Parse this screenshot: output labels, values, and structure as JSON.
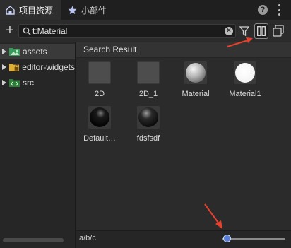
{
  "tabs": [
    {
      "label": "项目资源",
      "icon": "home-icon"
    },
    {
      "label": "小部件",
      "icon": "star-icon"
    }
  ],
  "header": {
    "help_label": "?"
  },
  "search": {
    "value": "t:Material",
    "clear_label": "×"
  },
  "toolbar": {
    "add_label": "+"
  },
  "tree": {
    "items": [
      {
        "label": "assets",
        "icon": "image-folder-icon",
        "expanded": false
      },
      {
        "label": "editor-widgets",
        "icon": "lock-folder-icon",
        "expanded": false
      },
      {
        "label": "src",
        "icon": "code-folder-icon",
        "expanded": false
      }
    ]
  },
  "results": {
    "title": "Search Result",
    "assets": [
      {
        "label": "2D",
        "kind": "sprite"
      },
      {
        "label": "2D_1",
        "kind": "sprite"
      },
      {
        "label": "Material",
        "kind": "material-gray"
      },
      {
        "label": "Material1",
        "kind": "material-white"
      },
      {
        "label": "Default…",
        "kind": "material-black"
      },
      {
        "label": "fdsfsdf",
        "kind": "material-dark"
      }
    ]
  },
  "footer": {
    "path": "a/b/c",
    "zoom_level": 0.0
  },
  "colors": {
    "accent": "#5a7fd6",
    "annotation": "#e8402b",
    "panel": "#2b2b2b"
  }
}
